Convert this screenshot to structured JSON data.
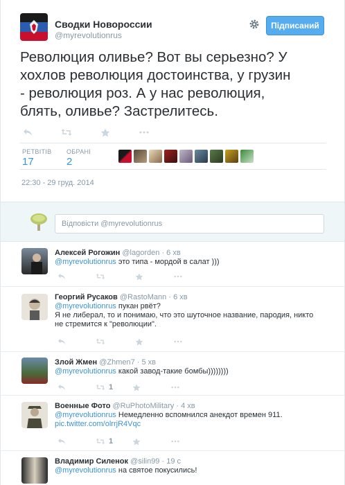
{
  "tweet": {
    "author_name": "Сводки Новороссии",
    "author_handle": "@myrevolutionrus",
    "follow_label": "Підписаний",
    "text_lines": [
      "Революция оливье? Вот вы серьезно? У",
      "хохлов революция достоинства, у грузин",
      "- революция роз. А у нас революция,",
      "блять, оливье? Застрелитесь."
    ],
    "stats": {
      "retweets_label": "РЕТВІТІВ",
      "retweets": "17",
      "favorites_label": "ОБРАНІ",
      "favorites": "2"
    },
    "timestamp": "22:30 - 29 груд. 2014"
  },
  "reply_box": {
    "placeholder": "Відповісти @myrevolutionrus"
  },
  "replies": [
    {
      "name": "Алексей Рогожин",
      "handle": "@lagorden",
      "time": "· 6 хв",
      "mention": "@myrevolutionrus",
      "text": " это типа - мордой в салат )))",
      "retweets": ""
    },
    {
      "name": "Георгий Русаков",
      "handle": "@RastoMann",
      "time": "· 6 хв",
      "mention": "@myrevolutionrus",
      "text": " пукан рвёт?",
      "text2": "Я не либерал, то и понимаю, что это шуточное название, пародия, никто",
      "text3": "не стремится к \"революции\".",
      "retweets": ""
    },
    {
      "name": "Злой Жмен",
      "handle": "@Zhmen7",
      "time": "· 5 хв",
      "mention": "@myrevolutionrus",
      "text": " какой завод-такие бомбы))))))))",
      "retweets": "1"
    },
    {
      "name": "Военные Фото",
      "handle": "@RuPhotoMilitary",
      "time": "· 4 хв",
      "mention": "@myrevolutionrus",
      "text": " Немедленно вспомнился анекдот времен 911.",
      "link": "pic.twitter.com/olrrjR4Vqc",
      "retweets": "1"
    },
    {
      "name": "Владимир Силенок",
      "handle": "@silin99",
      "time": "· 19 с",
      "mention": "@myrevolutionrus",
      "text": " на святое покусились!",
      "retweets": ""
    }
  ],
  "colors": {
    "accent": "#55acee",
    "link": "#3b94d9",
    "muted": "#8899a6"
  }
}
